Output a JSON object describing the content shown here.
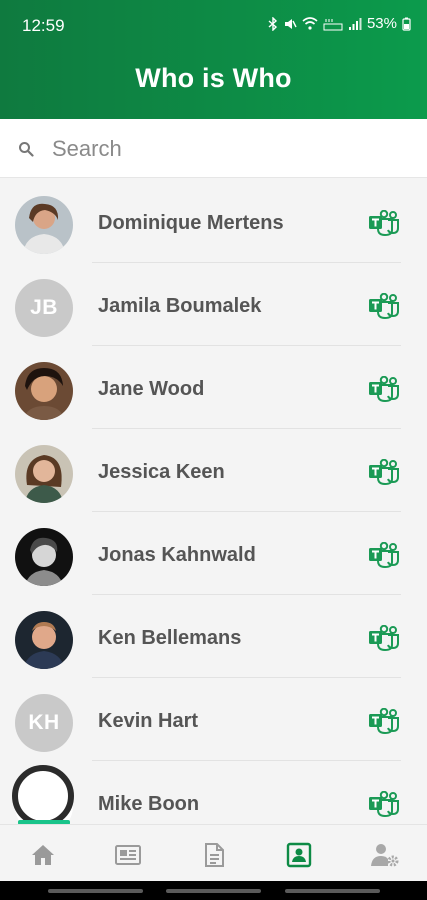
{
  "status_bar": {
    "time": "12:59",
    "battery": "53%"
  },
  "app": {
    "title": "Who is Who",
    "accent_color": "#0d8a45"
  },
  "search": {
    "placeholder": "Search",
    "icon": "search-icon"
  },
  "contacts": [
    {
      "name": "Dominique Mertens",
      "avatar": "photo"
    },
    {
      "name": "Jamila Boumalek",
      "avatar": "initials",
      "initials": "JB"
    },
    {
      "name": "Jane Wood",
      "avatar": "photo"
    },
    {
      "name": "Jessica Keen",
      "avatar": "photo"
    },
    {
      "name": "Jonas Kahnwald",
      "avatar": "photo"
    },
    {
      "name": "Ken Bellemans",
      "avatar": "photo"
    },
    {
      "name": "Kevin Hart",
      "avatar": "initials",
      "initials": "KH"
    },
    {
      "name": "Mike Boon",
      "avatar": "photo"
    }
  ],
  "bottom_nav": [
    {
      "icon": "home-icon",
      "active": false
    },
    {
      "icon": "news-icon",
      "active": false
    },
    {
      "icon": "document-icon",
      "active": false
    },
    {
      "icon": "contacts-icon",
      "active": true
    },
    {
      "icon": "user-settings-icon",
      "active": false
    }
  ]
}
